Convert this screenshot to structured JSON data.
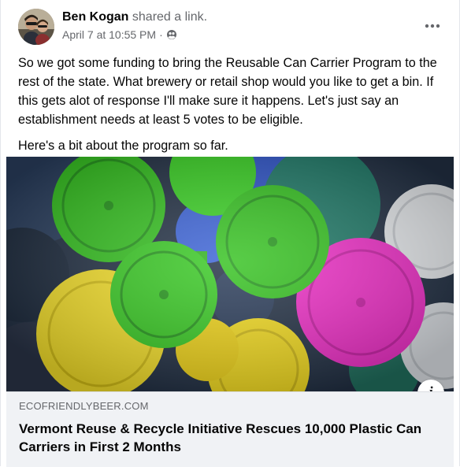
{
  "post": {
    "author_name": "Ben Kogan",
    "author_action": "shared a link.",
    "timestamp": "April 7 at 10:55 PM",
    "separator": "·",
    "privacy": "friends-icon",
    "body_paragraphs": [
      "So we got some funding to bring the Reusable Can Carrier Program to the rest of the state. What brewery or retail shop would you like to get a bin. If this gets alot of response I'll make sure it happens. Let's just say an establishment needs at least 5 votes to be eligible.",
      "Here's a bit about the program so far."
    ]
  },
  "link_preview": {
    "image_subject": "colorful-plastic-can-carriers",
    "domain": "ECOFRIENDLYBEER.COM",
    "title": "Vermont Reuse & Recycle Initiative Rescues 10,000 Plastic Can Carriers in First 2 Months",
    "info_icon": "info-icon"
  },
  "colors": {
    "text_primary": "#050505",
    "text_secondary": "#65676b",
    "footer_bg": "#f0f2f5",
    "carrier_green": "#34c21f",
    "carrier_yellow": "#f5e02a",
    "carrier_magenta": "#f02fc8",
    "carrier_white": "#e9ecef",
    "carrier_teal": "#1f7a68",
    "carrier_blue": "#2f55c9"
  }
}
